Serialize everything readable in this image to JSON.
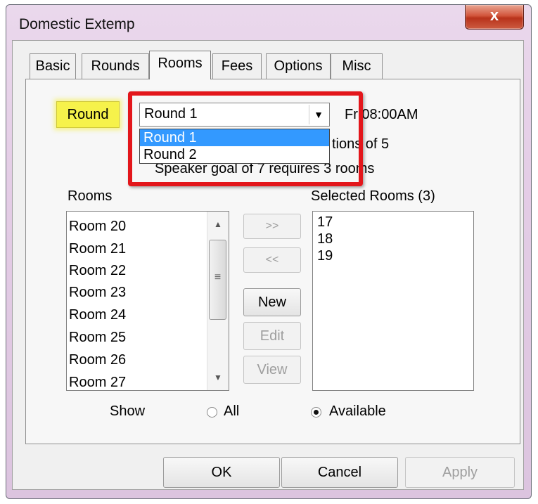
{
  "window": {
    "title": "Domestic Extemp",
    "close_label": "x"
  },
  "tabs": [
    {
      "label": "Basic"
    },
    {
      "label": "Rounds"
    },
    {
      "label": "Rooms",
      "active": true
    },
    {
      "label": "Fees"
    },
    {
      "label": "Options"
    },
    {
      "label": "Misc"
    }
  ],
  "round": {
    "label": "Round",
    "selected": "Round 1",
    "options": [
      "Round 1",
      "Round 2"
    ],
    "time": "Fr 08:00AM",
    "sections_text": "tions of 5",
    "speaker_goal_text": "Speaker goal of 7 requires 3 rooms"
  },
  "rooms": {
    "label": "Rooms",
    "items": [
      "Room 20",
      "Room 21",
      "Room 22",
      "Room 23",
      "Room 24",
      "Room 25",
      "Room 26",
      "Room 27"
    ]
  },
  "selected_rooms": {
    "label": "Selected Rooms (3)",
    "items": [
      "17",
      "18",
      "19"
    ]
  },
  "buttons": {
    "add": ">>",
    "remove": "<<",
    "new": "New",
    "edit": "Edit",
    "view": "View",
    "ok": "OK",
    "cancel": "Cancel",
    "apply": "Apply"
  },
  "show": {
    "label": "Show",
    "all": "All",
    "available": "Available",
    "selected": "Available"
  },
  "colors": {
    "highlight": "#f6f24b",
    "callout": "#e3161b",
    "selection": "#3399ff"
  }
}
